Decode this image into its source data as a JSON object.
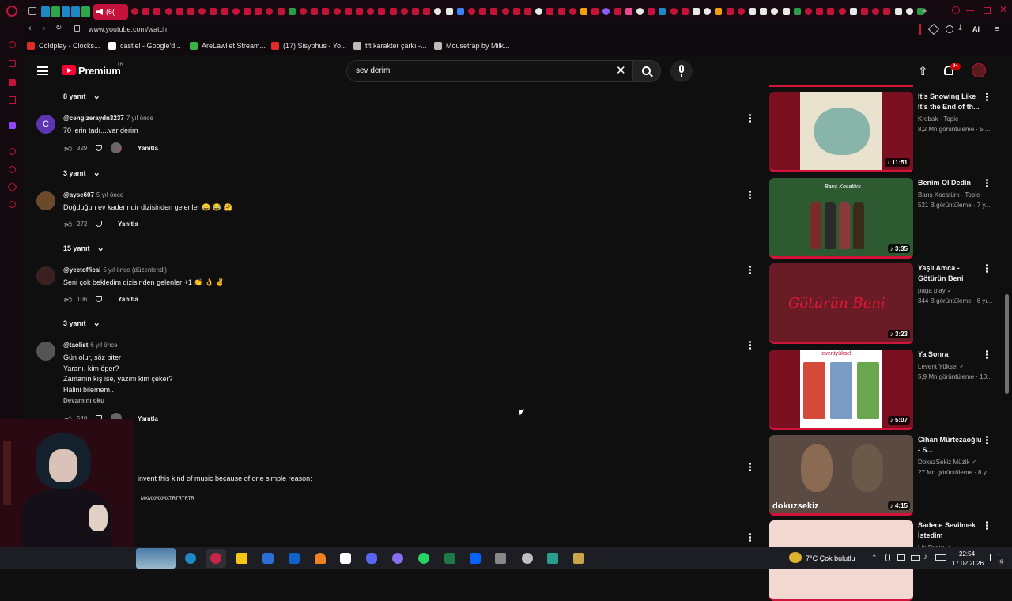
{
  "browser": {
    "tab_label": "(6(",
    "url": "www.youtube.com/watch",
    "ai_label": "AI",
    "bookmarks": [
      {
        "label": "Coldplay - Clocks...",
        "color": "#e02b2b"
      },
      {
        "label": "castiel - Google'd...",
        "color": "#ffffff"
      },
      {
        "label": "AreLawliet Stream...",
        "color": "#3cb043"
      },
      {
        "label": "(17) Sisyphus - Yo...",
        "color": "#e02b2b"
      },
      {
        "label": "tft karakter çarkı -...",
        "color": "#bbbbbb"
      },
      {
        "label": "Mousetrap by Milk...",
        "color": "#bbbbbb"
      }
    ]
  },
  "youtube": {
    "logo_text": "Premium",
    "logo_region": "TR",
    "search_value": "sev derim",
    "notification_badge": "9+"
  },
  "comments": [
    {
      "type": "replies",
      "label": "8 yanıt"
    },
    {
      "type": "comment",
      "author": "@cengizeraydn3237",
      "time": "7 yıl önce",
      "avatar_letter": "C",
      "avatar_color": "#5e35b1",
      "text": [
        "70 lerin tadı....var derim"
      ],
      "likes": "329",
      "reply_label": "Yanıtla"
    },
    {
      "type": "replies",
      "label": "3 yanıt"
    },
    {
      "type": "comment",
      "author": "@ayse607",
      "time": "5 yıl önce",
      "avatar_letter": "",
      "avatar_color": "#6b4a2c",
      "text": [
        "Doğduğun ev kaderindir dizisinden gelenler 😀 😂 🤗"
      ],
      "likes": "272",
      "reply_label": "Yanıtla"
    },
    {
      "type": "replies",
      "label": "15 yanıt"
    },
    {
      "type": "comment",
      "author": "@yeetoffical",
      "time": "5 yıl önce (düzenlendi)",
      "avatar_letter": "",
      "avatar_color": "#3a2020",
      "text": [
        "Seni çok bekledim dizisinden gelenler +1 👏 👌 ✌"
      ],
      "likes": "106",
      "reply_label": "Yanıtla"
    },
    {
      "type": "replies",
      "label": "3 yanıt"
    },
    {
      "type": "comment",
      "author": "@taolist",
      "time": "6 yıl önce",
      "avatar_letter": "",
      "avatar_color": "#555555",
      "text": [
        "Gün olur, söz biter",
        "Yaranı, kim öper?",
        "Zamanın kış ise, yazını kim çeker?",
        "Halini bilemem.."
      ],
      "more": "Devamını oku",
      "likes": "548",
      "reply_label": "Yanıtla"
    },
    {
      "type": "partial",
      "text_1": "invent this kind of music because of one simple reason:",
      "text_2": "MXMXMXMXTRTRTRTR"
    }
  ],
  "recommendations": [
    {
      "title": "It's Snowing Like It's the End of th...",
      "channel": "Krobak - Topic",
      "views": "8,2 Mn görüntüleme · 5 ...",
      "duration": "11:51",
      "bg": "#e9e2cf",
      "verified": false
    },
    {
      "title": "Benim Ol Dedin",
      "channel": "Barış Kocatürk - Topic",
      "views": "521 B görüntüleme · 7 y...",
      "duration": "3:35",
      "bg": "#2e5a32",
      "verified": false,
      "thumb_text": "Barış Kocatürk"
    },
    {
      "title": "Yaşlı Amca - Götürün Beni",
      "channel": "paga play",
      "views": "344 B görüntüleme · 6 yı...",
      "duration": "3:23",
      "bg": "#6a1c26",
      "verified": true,
      "thumb_text": "Götürün Beni"
    },
    {
      "title": "Ya Sonra",
      "channel": "Levent Yüksel",
      "views": "5,9 Mn görüntüleme · 10...",
      "duration": "5:07",
      "bg": "#ffffff",
      "verified": true,
      "thumb_text": "leventyüksel"
    },
    {
      "title": "Cihan Mürtezaoğlu - S...",
      "channel": "DokuzSekiz Müzik",
      "views": "27 Mn görüntüleme · 8 y...",
      "duration": "4:15",
      "bg": "#5a4a42",
      "verified": true,
      "thumb_text": "dokuzsekiz"
    },
    {
      "title": "Sadece Sevilmek İstedim",
      "channel": "Lin Pesto",
      "views": "",
      "duration": "",
      "bg": "#f2d8d0",
      "verified": true
    }
  ],
  "taskbar": {
    "weather": "7°C  Çok bulutlu",
    "time": "22:54",
    "date": "17.02.2026",
    "notif_count": "6"
  },
  "colors": {
    "accent": "#d2143a",
    "bg": "#0f0f0f",
    "muted": "#aaaaaa"
  }
}
